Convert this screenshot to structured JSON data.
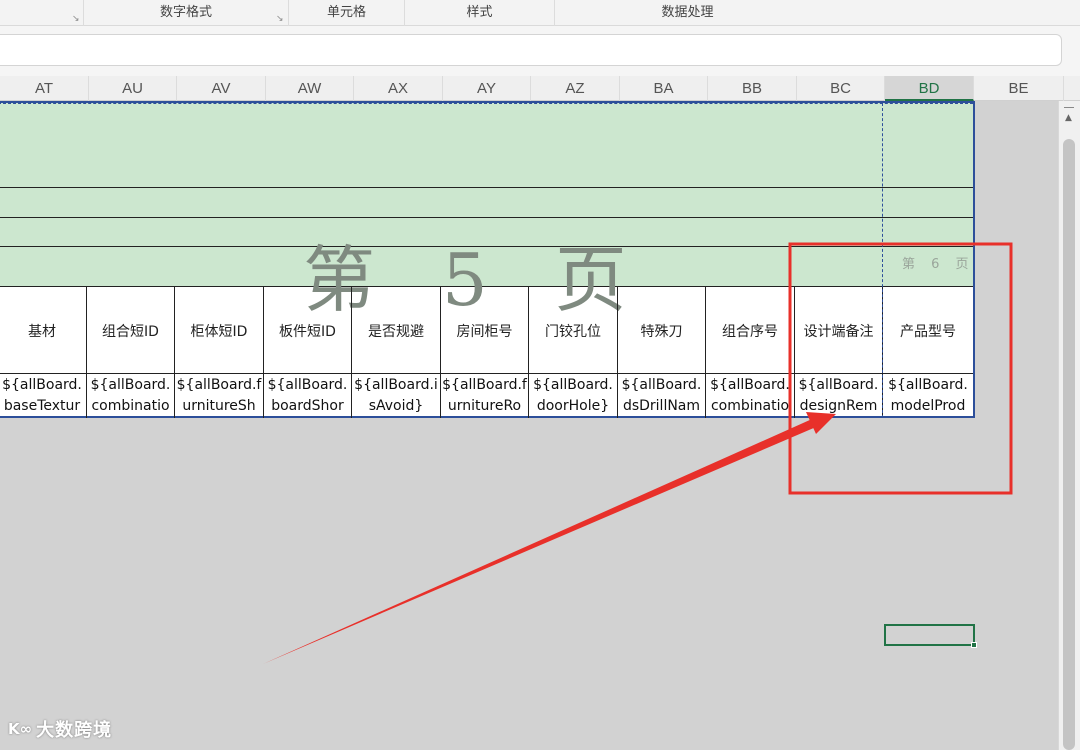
{
  "ribbon": {
    "groups": [
      "数字格式",
      "单元格",
      "样式",
      "数据处理"
    ],
    "launcher_glyph": "↘"
  },
  "columns": [
    "AT",
    "AU",
    "AV",
    "AW",
    "AX",
    "AY",
    "AZ",
    "BA",
    "BB",
    "BC",
    "BD",
    "BE"
  ],
  "active_column": "BD",
  "table": {
    "headers": [
      "基材",
      "组合短ID",
      "柜体短ID",
      "板件短ID",
      "是否规避",
      "房间柜号",
      "门铰孔位",
      "特殊刀",
      "组合序号",
      "设计端备注",
      "产品型号"
    ],
    "cells": [
      "${allBoard.\nbaseTextur",
      "${allBoard.\ncombinatio",
      "${allBoard.f\nurnitureSh",
      "${allBoard.\nboardShor",
      "${allBoard.i\nsAvoid}",
      "${allBoard.f\nurnitureRo",
      "${allBoard.\ndoorHole}",
      "${allBoard.\ndsDrillNam",
      "${allBoard.\ncombinatio",
      "${allBoard.\ndesignRem",
      "${allBoard.\nmodelProd"
    ]
  },
  "watermarks": {
    "page5": "第 5 页",
    "page6": "第 6 页"
  },
  "logo": {
    "mark": "K∞",
    "text": "大数跨境"
  },
  "colors": {
    "band_fill": "#cce7cf",
    "print_border": "#2d4f9a",
    "annotation_red": "#e8302a",
    "active_green": "#217346"
  }
}
